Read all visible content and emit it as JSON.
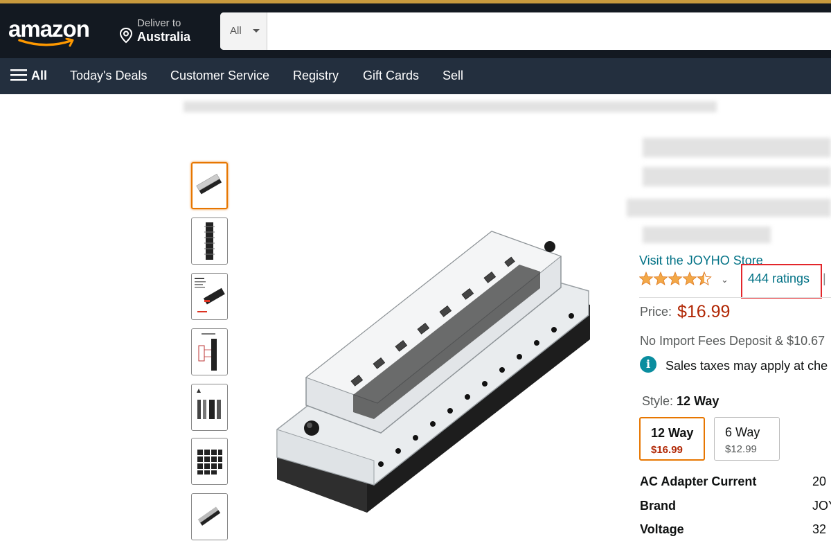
{
  "header": {
    "logo_text": "amazon",
    "deliver_line1": "Deliver to",
    "deliver_line2": "Australia",
    "search_category": "All",
    "search_placeholder": ""
  },
  "nav": {
    "all_label": "All",
    "items": [
      "Today's Deals",
      "Customer Service",
      "Registry",
      "Gift Cards",
      "Sell"
    ]
  },
  "product": {
    "store_link": "Visit the JOYHO Store",
    "rating_stars": 4.5,
    "ratings_text": "444 ratings",
    "separator": "|",
    "price_label": "Price:",
    "price_value": "$16.99",
    "import_text": "No Import Fees Deposit & $10.67",
    "tax_text": "Sales taxes may apply at che",
    "style_label": "Style:",
    "style_value": "12 Way",
    "options": [
      {
        "name": "12 Way",
        "price": "$16.99",
        "selected": true
      },
      {
        "name": "6 Way",
        "price": "$12.99",
        "selected": false
      }
    ],
    "specs": [
      {
        "key": "AC Adapter Current",
        "value": "20"
      },
      {
        "key": "Brand",
        "value": "JOY"
      },
      {
        "key": "Voltage",
        "value": "32"
      }
    ]
  },
  "colors": {
    "header_bg": "#131921",
    "nav_bg": "#232f3e",
    "link": "#007185",
    "price": "#b12704",
    "star": "#f3a847",
    "selected_border": "#e77600",
    "highlight_box": "#e3262b"
  },
  "icons": [
    "location-pin-icon",
    "hamburger-icon",
    "star-icon",
    "chevron-down-icon",
    "info-icon"
  ]
}
